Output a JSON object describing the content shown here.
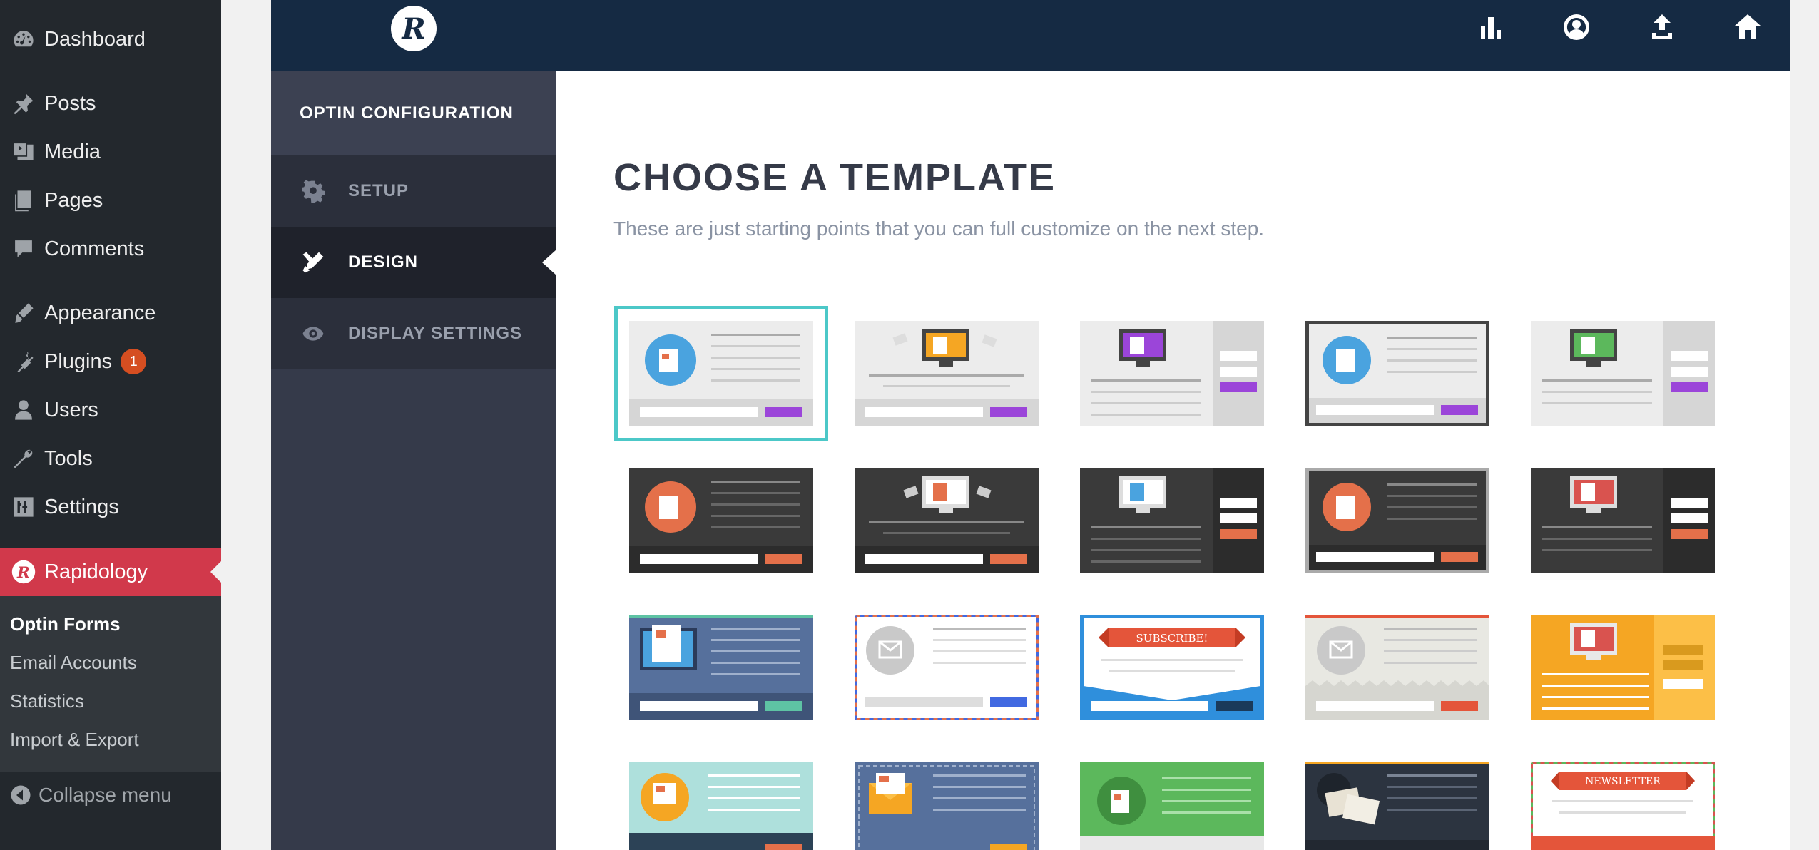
{
  "wp_menu": {
    "items": [
      {
        "label": "Dashboard",
        "icon": "dashboard-icon"
      },
      {
        "label": "Posts",
        "icon": "pin-icon"
      },
      {
        "label": "Media",
        "icon": "media-icon"
      },
      {
        "label": "Pages",
        "icon": "pages-icon"
      },
      {
        "label": "Comments",
        "icon": "comment-icon"
      },
      {
        "label": "Appearance",
        "icon": "brush-icon"
      },
      {
        "label": "Plugins",
        "icon": "plugin-icon",
        "badge": "1"
      },
      {
        "label": "Users",
        "icon": "user-icon"
      },
      {
        "label": "Tools",
        "icon": "wrench-icon"
      },
      {
        "label": "Settings",
        "icon": "sliders-icon"
      }
    ],
    "active": {
      "label": "Rapidology",
      "icon": "rapidology-icon"
    },
    "submenu": [
      "Optin Forms",
      "Email Accounts",
      "Statistics",
      "Import & Export"
    ],
    "collapse_label": "Collapse menu"
  },
  "header": {
    "logo_letter": "R",
    "icons": [
      "bar-chart-icon",
      "user-circle-icon",
      "upload-icon",
      "home-icon"
    ]
  },
  "config_nav": {
    "title": "OPTIN CONFIGURATION",
    "items": [
      {
        "label": "SETUP",
        "icon": "gear-icon"
      },
      {
        "label": "DESIGN",
        "icon": "pencil-ruler-icon",
        "active": true
      },
      {
        "label": "DISPLAY SETTINGS",
        "icon": "eye-icon"
      }
    ]
  },
  "main": {
    "title": "CHOOSE A TEMPLATE",
    "description": "These are just starting points that you can full customize on the next step.",
    "template_labels": {
      "subscribe": "SUBSCRIBE!",
      "newsletter": "NEWSLETTER"
    },
    "selected_template": 1
  },
  "colors": {
    "wp_sidebar": "#23282d",
    "wp_active": "#d1394b",
    "header_bg": "#152a43",
    "nav_bg": "#353a4a",
    "selected_outline": "#4cc8c8",
    "purple_button": "#9b45d9",
    "orange_button": "#e4704a"
  }
}
